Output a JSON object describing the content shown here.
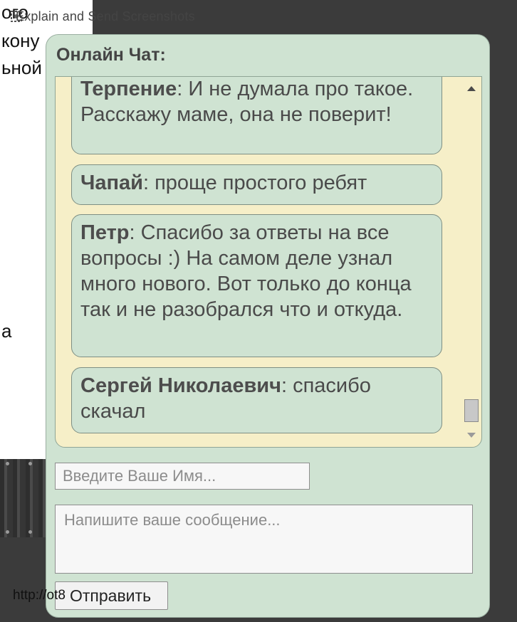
{
  "background_page": {
    "lines": [
      "ого",
      "кону",
      "ьной",
      "а"
    ]
  },
  "overlay": {
    "text": "Explain and Send Screenshots",
    "icon": "screenshot-app-icon"
  },
  "bottom_url": "http://ot8",
  "chat": {
    "title": "Онлайн Чат:",
    "messages": [
      {
        "author": "Терпение",
        "text": ": И не думала про такое. Расскажу маме, она не поверит!"
      },
      {
        "author": "Чапай",
        "text": ": проще простого ребят"
      },
      {
        "author": "Петр",
        "text": ": Спасибо за ответы на все вопросы :) На самом деле узнал много нового. Вот только до конца так и не разобрался что и откуда."
      },
      {
        "author": "Сергей Николаевич",
        "text": ": спасибо скачал"
      }
    ],
    "name_input": {
      "placeholder": "Введите Ваше Имя..."
    },
    "message_input": {
      "placeholder": "Напишите ваше сообщение..."
    },
    "send_label": "Отправить"
  },
  "colors": {
    "panel": "#cfe3d2",
    "messages_bg": "#f6efc8",
    "border": "#7e8f84"
  }
}
